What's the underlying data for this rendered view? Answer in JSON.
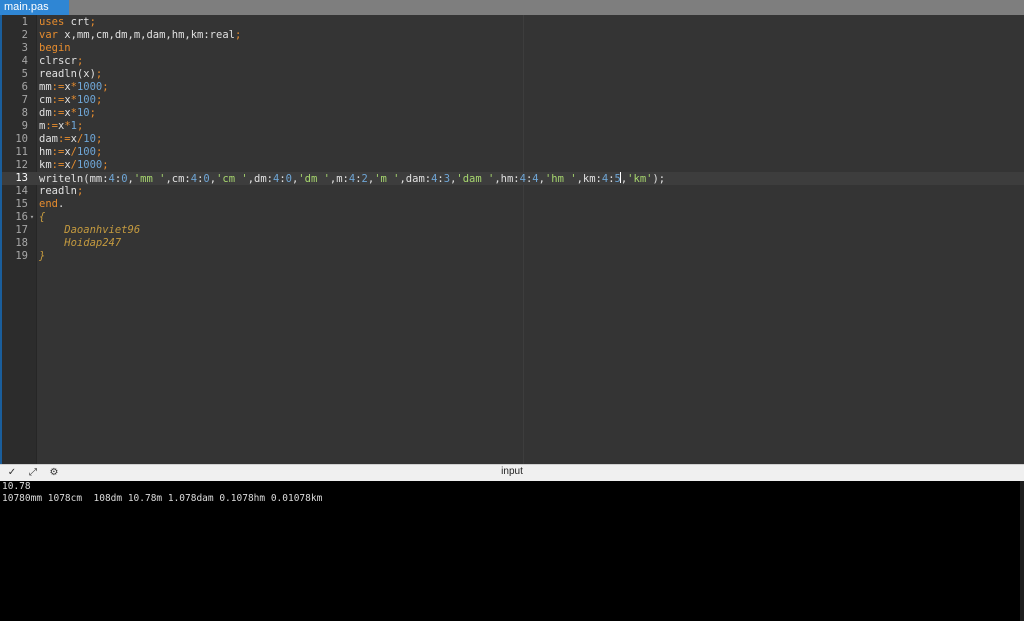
{
  "tabs": [
    {
      "label": "main.pas",
      "active": true
    }
  ],
  "editor": {
    "active_line": 13,
    "line_numbers": [
      "1",
      "2",
      "3",
      "4",
      "5",
      "6",
      "7",
      "8",
      "9",
      "10",
      "11",
      "12",
      "13",
      "14",
      "15",
      "16",
      "17",
      "18",
      "19"
    ],
    "fold_markers": {
      "16": "▾"
    },
    "tokens": {
      "l1": [
        "uses",
        " crt",
        ";"
      ],
      "l2": [
        "var",
        " x,mm,cm,dm,m,dam,hm,km:real",
        ";"
      ],
      "l3": [
        "begin"
      ],
      "l4": [
        "clrscr",
        ";"
      ],
      "l5": [
        "readln(x)",
        ";"
      ],
      "l6": [
        "mm",
        ":=",
        "x",
        "*",
        "1000",
        ";"
      ],
      "l7": [
        "cm",
        ":=",
        "x",
        "*",
        "100",
        ";"
      ],
      "l8": [
        "dm",
        ":=",
        "x",
        "*",
        "10",
        ";"
      ],
      "l9": [
        "m",
        ":=",
        "x",
        "*",
        "1",
        ";"
      ],
      "l10": [
        "dam",
        ":=",
        "x",
        "/",
        "10",
        ";"
      ],
      "l11": [
        "hm",
        ":=",
        "x",
        "/",
        "100",
        ";"
      ],
      "l12": [
        "km",
        ":=",
        "x",
        "/",
        "1000",
        ";"
      ],
      "l13": [
        "writeln(mm:",
        "4",
        ":",
        "0",
        ",",
        "'mm '",
        ",cm:",
        "4",
        ":",
        "0",
        ",",
        "'cm '",
        ",dm:",
        "4",
        ":",
        "0",
        ",",
        "'dm '",
        ",m:",
        "4",
        ":",
        "2",
        ",",
        "'m '",
        ",dam:",
        "4",
        ":",
        "3",
        ",",
        "'dam '",
        ",hm:",
        "4",
        ":",
        "4",
        ",",
        "'hm '",
        ",km:",
        "4",
        ":",
        "5",
        ",",
        "'km'",
        ");"
      ],
      "l14": [
        "readln",
        ";"
      ],
      "l15": [
        "end",
        "."
      ],
      "l16": [
        "{"
      ],
      "l17": [
        "    Daoanhviet96"
      ],
      "l18": [
        "    Hoidap247"
      ],
      "l19": [
        "}"
      ]
    }
  },
  "panel": {
    "title": "input",
    "buttons": [
      {
        "name": "collapse",
        "glyph": "✓"
      },
      {
        "name": "maximize",
        "glyph": "⤢"
      },
      {
        "name": "settings",
        "glyph": "⚙"
      }
    ]
  },
  "console": {
    "lines": [
      "10.78",
      "10780mm 1078cm  108dm 10.78m 1.078dam 0.1078hm 0.01078km"
    ]
  },
  "colors": {
    "keyword": "#e68c2e",
    "number": "#6fa6d6",
    "string": "#a7d66e",
    "comment": "#c49a3f",
    "tab_active": "#2f86d4"
  }
}
